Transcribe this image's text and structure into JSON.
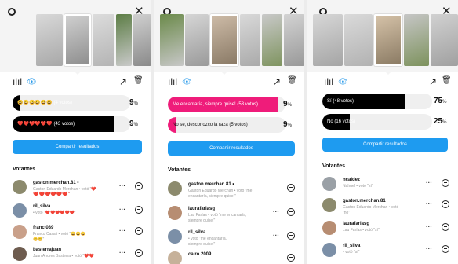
{
  "icons": {
    "settings": "gear-icon",
    "close": "close-icon",
    "results": "bar-chart-icon",
    "views": "eye-icon",
    "trending": "trending-up-icon",
    "delete": "trash-icon",
    "close_glyph": "✕",
    "chart_glyph": "ılıl",
    "eye_glyph": "👁",
    "trend_glyph": "↗",
    "trash_glyph": "🗑",
    "more_glyph": "···"
  },
  "colors": {
    "black": "#000000",
    "pink": "#ef1c7a",
    "blue": "#1e9bf0"
  },
  "panels": [
    {
      "options": [
        {
          "label": "😀😀😀😀😀😀 (4 votos)",
          "percent": 9,
          "fill_fraction": 0.06,
          "fill_color": "#000000",
          "text_color": "#ffffff"
        },
        {
          "label": "❤️❤️❤️❤️❤️❤️ (43 votos)",
          "percent": 9,
          "fill_fraction": 0.86,
          "fill_color": "#000000",
          "text_color": "#ffffff"
        }
      ],
      "share_label": "Compartir resultados",
      "voters_title": "Votantes",
      "voters": [
        {
          "username": "gaston.merchan.81 •",
          "desc1": "Gaston Eduardo Merchan • votó \"❤️",
          "desc2": "❤️❤️❤️❤️❤️❤️\"",
          "avatar": "#8c8a6d"
        },
        {
          "username": "ril_silva",
          "desc1": "• votó \"❤️❤️❤️❤️❤️❤️\"",
          "desc2": "",
          "avatar": "#7b8fa7"
        },
        {
          "username": "franc.089",
          "desc1": "Franco Casati • votó \"😀😀😀",
          "desc2": "😀😀\"",
          "avatar": "#c9a08a"
        },
        {
          "username": "basterrajuan",
          "desc1": "Juan Andres Basterra • votó \"❤️❤️",
          "desc2": "",
          "avatar": "#6e5c4f"
        }
      ]
    },
    {
      "options": [
        {
          "label": "Me encantaría, siempre quise! (53 votos)",
          "percent": 9,
          "fill_fraction": 0.93,
          "fill_color": "#ef1c7a",
          "text_color": "#ffffff"
        },
        {
          "label": "No sé, desconozco la raza (5 votos)",
          "percent": 9,
          "fill_fraction": 0.07,
          "fill_color": "#ef1c7a",
          "text_color": "#111111"
        }
      ],
      "share_label": "Compartir resultados",
      "voters_title": "Votantes",
      "voters": [
        {
          "username": "gaston.merchan.81 •",
          "desc1": "Gaston Eduardo Merchan • votó \"me",
          "desc2": "encantaría, siempre quise!\"",
          "avatar": "#8c8a6d"
        },
        {
          "username": "laurafariasg",
          "desc1": "Lau Farías • votó \"me encantaría,",
          "desc2": "siempre quise!\"",
          "avatar": "#b78d72"
        },
        {
          "username": "ril_silva",
          "desc1": "• votó \"me encantaría,",
          "desc2": "siempre quise!\"",
          "avatar": "#7b8fa7"
        },
        {
          "username": "ca.ro.2009",
          "desc1": "",
          "desc2": "",
          "avatar": "#c6b19a"
        }
      ]
    },
    {
      "options": [
        {
          "label": "Sí (48 votos)",
          "percent": 75,
          "fill_fraction": 0.75,
          "fill_color": "#000000",
          "text_color": "#ffffff"
        },
        {
          "label": "No (16 votos)",
          "percent": 25,
          "fill_fraction": 0.25,
          "fill_color": "#000000",
          "text_color": "#ffffff"
        }
      ],
      "share_label": "Compartir resultados",
      "voters_title": "Votantes",
      "voters": [
        {
          "username": "ncaldez",
          "desc1": "Nahuel • votó \"sí\"",
          "desc2": "",
          "avatar": "#9aa0a6"
        },
        {
          "username": "gaston.merchan.81",
          "desc1": "Gaston Eduardo Merchan • votó",
          "desc2": "\"no\"",
          "avatar": "#8c8a6d"
        },
        {
          "username": "laurafariasg",
          "desc1": "Lau Farías • votó \"sí\"",
          "desc2": "",
          "avatar": "#b78d72"
        },
        {
          "username": "ril_silva",
          "desc1": "• votó \"sí\"",
          "desc2": "",
          "avatar": "#7b8fa7"
        }
      ]
    }
  ]
}
